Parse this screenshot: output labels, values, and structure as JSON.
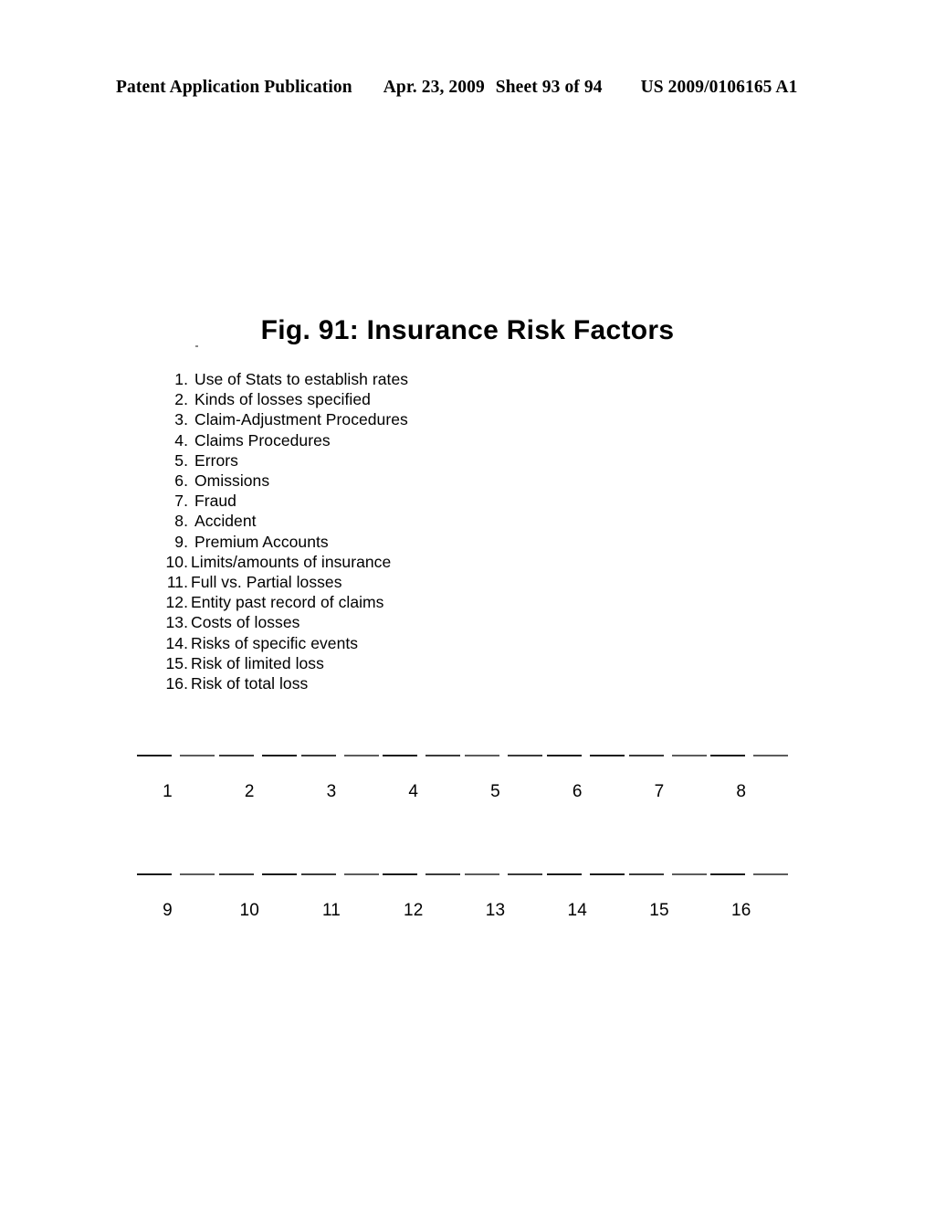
{
  "header": {
    "left": "Patent Application Publication",
    "date": "Apr. 23, 2009",
    "sheet": "Sheet 93 of 94",
    "publication_number": "US 2009/0106165 A1"
  },
  "figure": {
    "title": "Fig. 91: Insurance Risk Factors",
    "number": "91",
    "items": [
      {
        "num": "1.",
        "text": "Use of Stats to establish rates"
      },
      {
        "num": "2.",
        "text": "Kinds of losses specified"
      },
      {
        "num": "3.",
        "text": "Claim-Adjustment Procedures"
      },
      {
        "num": "4.",
        "text": "Claims Procedures"
      },
      {
        "num": "5.",
        "text": "Errors"
      },
      {
        "num": "6.",
        "text": "Omissions"
      },
      {
        "num": "7.",
        "text": "Fraud"
      },
      {
        "num": "8.",
        "text": "Accident"
      },
      {
        "num": "9.",
        "text": "Premium Accounts"
      },
      {
        "num": "10.",
        "text": "Limits/amounts of insurance"
      },
      {
        "num": "11.",
        "text": "Full vs. Partial losses"
      },
      {
        "num": "12.",
        "text": "Entity past record of claims"
      },
      {
        "num": "13.",
        "text": "Costs of losses"
      },
      {
        "num": "14.",
        "text": "Risks of specific events"
      },
      {
        "num": "15.",
        "text": "Risk of limited loss"
      },
      {
        "num": "16.",
        "text": "Risk of total loss"
      }
    ]
  },
  "slot_rows": [
    {
      "name": "slots-1-8",
      "labels": [
        "1",
        "2",
        "3",
        "4",
        "5",
        "6",
        "7",
        "8"
      ]
    },
    {
      "name": "slots-9-16",
      "labels": [
        "9",
        "10",
        "11",
        "12",
        "13",
        "14",
        "15",
        "16"
      ]
    }
  ],
  "colors": {
    "page_background": "#ffffff",
    "ink": "#000000",
    "dash_dark": "#1a1a1a",
    "dash_mid": "#3a3a3a",
    "dash_faint": "#5c5c5c"
  }
}
